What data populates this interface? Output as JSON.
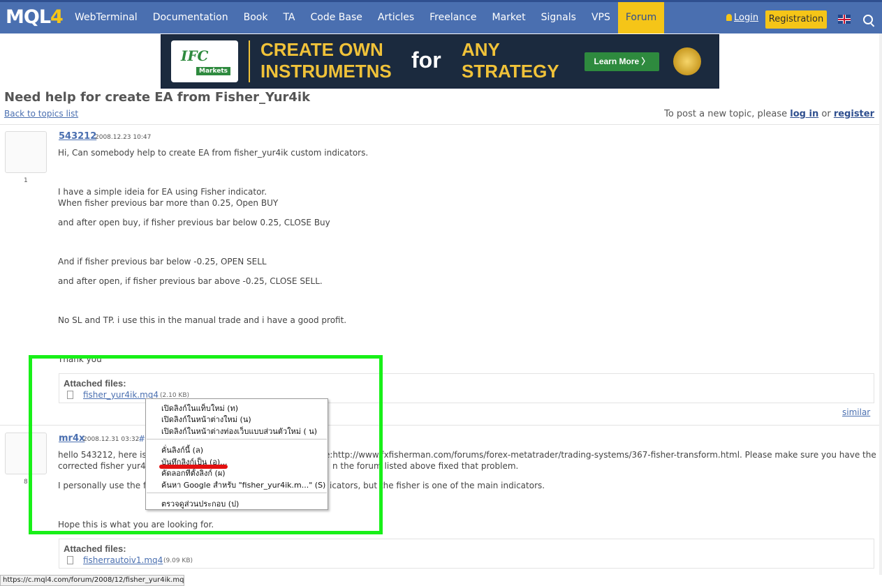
{
  "header": {
    "logo_main": "MQL",
    "logo_suffix": "4",
    "nav": [
      "WebTerminal",
      "Documentation",
      "Book",
      "TA",
      "Code Base",
      "Articles",
      "Freelance",
      "Market",
      "Signals",
      "VPS",
      "Forum"
    ],
    "active_nav": "Forum",
    "login_label": "Login",
    "registration_label": "Registration"
  },
  "banner": {
    "brand": "IFC",
    "brand_sub": "Markets",
    "line1a": "CREATE OWN",
    "line1b": "INSTRUMETNS",
    "connector": "for",
    "line2a": "ANY",
    "line2b": "STRATEGY",
    "cta": "Learn More  〉"
  },
  "topic": {
    "title": "Need help for create EA from Fisher_Yur4ik",
    "back_link": "Back to topics list",
    "hint_prefix": "To post a new topic, please",
    "hint_login": "log in",
    "hint_or": "or",
    "hint_register": "register"
  },
  "post1": {
    "author": "543212",
    "date": "2008.12.23 10:47",
    "rank": "1",
    "lines": [
      "Hi, Can somebody help to create EA from fisher_yur4ik custom indicators.",
      "I have a simple ideia for EA using Fisher indicator.",
      "When fisher previous bar more than 0.25, Open BUY",
      "and after open buy, if fisher previous bar below 0.25, CLOSE Buy",
      "And if fisher previous bar below -0.25, OPEN SELL",
      "and after open, if fisher previous bar above -0.25, CLOSE SELL.",
      "No SL and TP. i use this in the manual trade and i have a good profit.",
      "Thank you"
    ],
    "attach_title": "Attached files:",
    "file_name": "fisher_yur4ik.mq4",
    "file_size": "(2.10 KB)",
    "similar": "similar"
  },
  "post2": {
    "author": "mr4x",
    "date": "2008.12.31 03:32",
    "hash": "#",
    "rank": "8",
    "line1_left": "hello 543212, here is",
    "line1_right": "e:http://www.fxfisherman.com/forums/forex-metatrader/trading-systems/367-fisher-transform.html. Please make sure you have the",
    "line2_left": "corrected fisher yur4ik",
    "line2_right": "n the forum listed above fixed that problem.",
    "line3_left": "I personally use the fis",
    "line3_right": "icators, but the fisher is one of the main indicators.",
    "line4": "Hope this is what you are looking for.",
    "attach_title": "Attached files:",
    "file_name": "fisherrautoiv1.mq4",
    "file_size": "(9.09 KB)"
  },
  "context_menu": {
    "items": [
      "เปิดลิงก์ในแท็บใหม่ (ท)",
      "เปิดลิงก์ในหน้าต่างใหม่ (น)",
      "เปิดลิงก์ในหน้าต่างท่องเว็บแบบส่วนตัวใหม่ ( น)",
      "คั่นลิงก์นี้ (ล)",
      "บันทึกลิงก์เป็น (อ)...",
      "คัดลอกที่ตั้งลิงก์ (ผ)",
      "ค้นหา Google สำหรับ \"fisher_yur4ik.m...\" (S)",
      "ตรวจดูส่วนประกอบ (ป)"
    ]
  },
  "status_bar": {
    "url": "https://c.mql4.com/forum/2008/12/fisher_yur4ik.mq4"
  },
  "colors": {
    "nav_bg": "#4a6fb0",
    "accent": "#f5c518",
    "highlight_box": "#18f018",
    "annotation_red": "#e31010"
  }
}
